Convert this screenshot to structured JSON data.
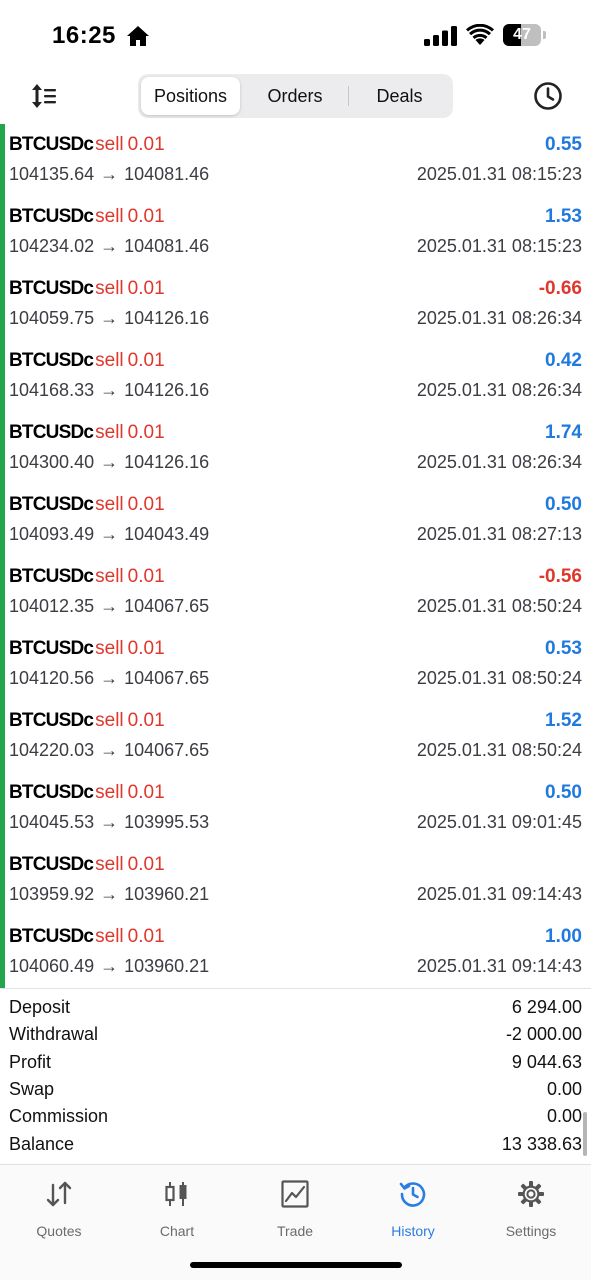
{
  "status_bar": {
    "time": "16:25",
    "battery": "47",
    "battery_fraction": 0.47
  },
  "toolbar": {
    "tabs": [
      {
        "label": "Positions",
        "active": true
      },
      {
        "label": "Orders",
        "active": false
      },
      {
        "label": "Deals",
        "active": false
      }
    ]
  },
  "colors": {
    "positive": "#1f7ae0",
    "negative": "#e0372c",
    "accent": "#2a7de1",
    "marker": "#23a64b"
  },
  "deals": [
    {
      "symbol": "BTCUSDc",
      "side": "sell",
      "volume": "0.01",
      "profit": "0.55",
      "open": "104135.64",
      "close": "104081.46",
      "time": "2025.01.31 08:15:23"
    },
    {
      "symbol": "BTCUSDc",
      "side": "sell",
      "volume": "0.01",
      "profit": "1.53",
      "open": "104234.02",
      "close": "104081.46",
      "time": "2025.01.31 08:15:23"
    },
    {
      "symbol": "BTCUSDc",
      "side": "sell",
      "volume": "0.01",
      "profit": "-0.66",
      "open": "104059.75",
      "close": "104126.16",
      "time": "2025.01.31 08:26:34"
    },
    {
      "symbol": "BTCUSDc",
      "side": "sell",
      "volume": "0.01",
      "profit": "0.42",
      "open": "104168.33",
      "close": "104126.16",
      "time": "2025.01.31 08:26:34"
    },
    {
      "symbol": "BTCUSDc",
      "side": "sell",
      "volume": "0.01",
      "profit": "1.74",
      "open": "104300.40",
      "close": "104126.16",
      "time": "2025.01.31 08:26:34"
    },
    {
      "symbol": "BTCUSDc",
      "side": "sell",
      "volume": "0.01",
      "profit": "0.50",
      "open": "104093.49",
      "close": "104043.49",
      "time": "2025.01.31 08:27:13"
    },
    {
      "symbol": "BTCUSDc",
      "side": "sell",
      "volume": "0.01",
      "profit": "-0.56",
      "open": "104012.35",
      "close": "104067.65",
      "time": "2025.01.31 08:50:24"
    },
    {
      "symbol": "BTCUSDc",
      "side": "sell",
      "volume": "0.01",
      "profit": "0.53",
      "open": "104120.56",
      "close": "104067.65",
      "time": "2025.01.31 08:50:24"
    },
    {
      "symbol": "BTCUSDc",
      "side": "sell",
      "volume": "0.01",
      "profit": "1.52",
      "open": "104220.03",
      "close": "104067.65",
      "time": "2025.01.31 08:50:24"
    },
    {
      "symbol": "BTCUSDc",
      "side": "sell",
      "volume": "0.01",
      "profit": "0.50",
      "open": "104045.53",
      "close": "103995.53",
      "time": "2025.01.31 09:01:45"
    },
    {
      "symbol": "BTCUSDc",
      "side": "sell",
      "volume": "0.01",
      "profit": "",
      "open": "103959.92",
      "close": "103960.21",
      "time": "2025.01.31 09:14:43"
    },
    {
      "symbol": "BTCUSDc",
      "side": "sell",
      "volume": "0.01",
      "profit": "1.00",
      "open": "104060.49",
      "close": "103960.21",
      "time": "2025.01.31 09:14:43"
    }
  ],
  "summary": [
    {
      "label": "Deposit",
      "value": "6 294.00"
    },
    {
      "label": "Withdrawal",
      "value": "-2 000.00"
    },
    {
      "label": "Profit",
      "value": "9 044.63"
    },
    {
      "label": "Swap",
      "value": "0.00"
    },
    {
      "label": "Commission",
      "value": "0.00"
    },
    {
      "label": "Balance",
      "value": "13 338.63"
    }
  ],
  "tabbar": {
    "items": [
      {
        "label": "Quotes",
        "icon": "quotes-icon",
        "active": false
      },
      {
        "label": "Chart",
        "icon": "candles-icon",
        "active": false
      },
      {
        "label": "Trade",
        "icon": "trade-icon",
        "active": false
      },
      {
        "label": "History",
        "icon": "history-icon",
        "active": true
      },
      {
        "label": "Settings",
        "icon": "gear-icon",
        "active": false
      }
    ]
  }
}
